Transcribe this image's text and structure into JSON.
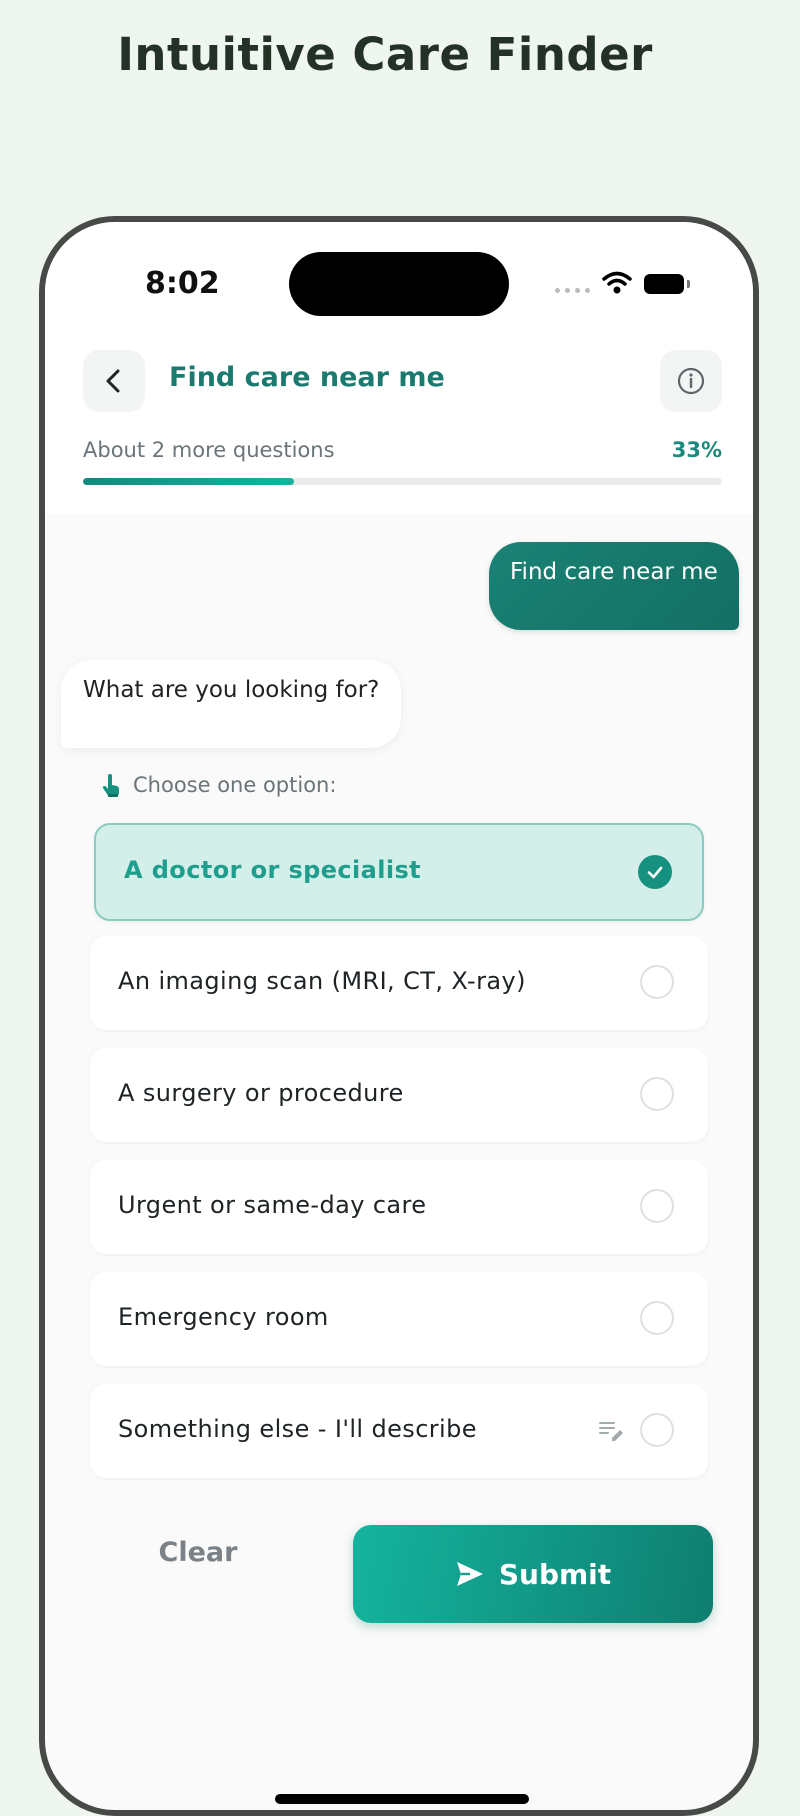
{
  "promo": {
    "title": "Intuitive Care Finder"
  },
  "status_bar": {
    "time": "8:02"
  },
  "header": {
    "title": "Find care near me",
    "back_icon": "chevron-left-icon",
    "info_icon": "info-icon"
  },
  "progress": {
    "label": "About 2 more questions",
    "percent_text": "33%",
    "value": 0.33
  },
  "chat": {
    "user_message": "Find care near me",
    "bot_message": "What are you looking for?",
    "choose_label": "Choose one option:"
  },
  "options": [
    {
      "label": "A doctor or specialist",
      "selected": true
    },
    {
      "label": "An imaging scan (MRI, CT, X-ray)",
      "selected": false
    },
    {
      "label": "A surgery or procedure",
      "selected": false
    },
    {
      "label": "Urgent or same-day care",
      "selected": false
    },
    {
      "label": "Emergency room",
      "selected": false
    },
    {
      "label": "Something else - I'll describe",
      "selected": false
    }
  ],
  "actions": {
    "clear_label": "Clear",
    "submit_label": "Submit"
  },
  "colors": {
    "accent": "#17917f",
    "background": "#eff6ef",
    "selected_bg": "#d4eeea"
  }
}
